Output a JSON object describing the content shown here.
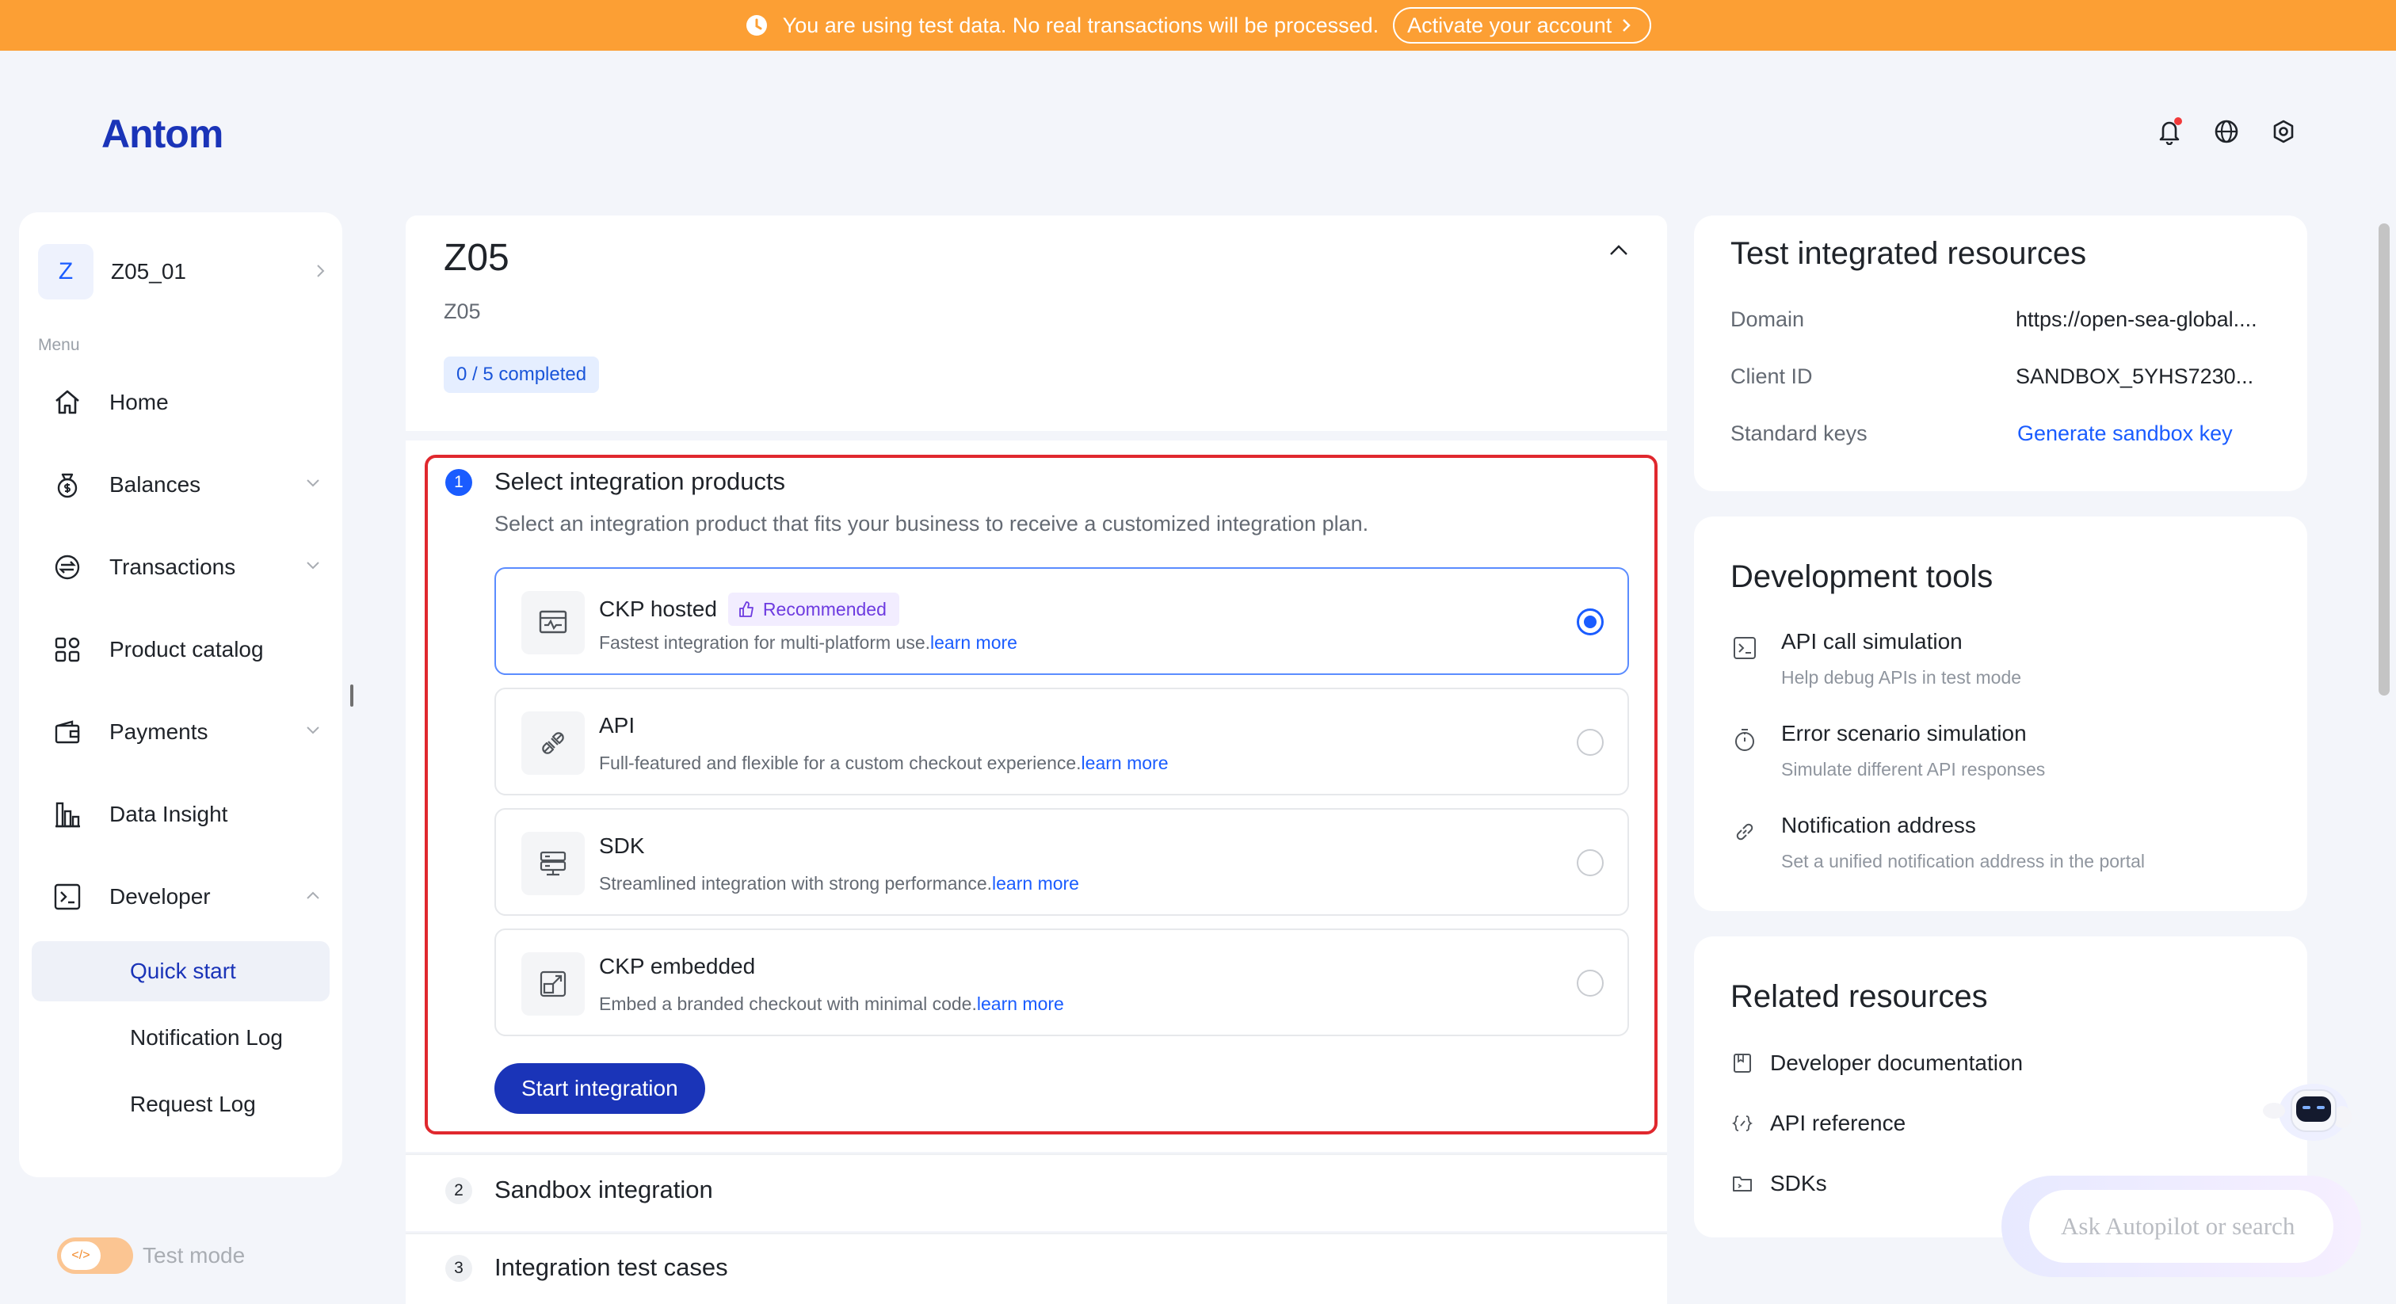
{
  "banner": {
    "message": "You are using test data. No real transactions will be processed.",
    "activate_label": "Activate your account"
  },
  "header": {
    "logo": "Antom"
  },
  "sidebar": {
    "account": {
      "initial": "Z",
      "name": "Z05_01"
    },
    "menu_label": "Menu",
    "items": [
      {
        "label": "Home"
      },
      {
        "label": "Balances"
      },
      {
        "label": "Transactions"
      },
      {
        "label": "Product catalog"
      },
      {
        "label": "Payments"
      },
      {
        "label": "Data Insight"
      },
      {
        "label": "Developer"
      }
    ],
    "developer_sub": [
      {
        "label": "Quick start",
        "active": true
      },
      {
        "label": "Notification Log"
      },
      {
        "label": "Request Log"
      }
    ],
    "test_mode_label": "Test mode"
  },
  "main": {
    "title": "Z05",
    "subtitle": "Z05",
    "progress": "0 / 5 completed",
    "steps": [
      {
        "number": "1",
        "title": "Select integration products",
        "description": "Select an integration product that fits your business to receive a customized integration plan.",
        "options": [
          {
            "title": "CKP hosted",
            "badge": "Recommended",
            "description": "Fastest integration for multi-platform use.",
            "link": "learn more",
            "selected": true
          },
          {
            "title": "API",
            "description": "Full-featured and flexible for a custom checkout experience.",
            "link": "learn more",
            "selected": false
          },
          {
            "title": "SDK",
            "description": "Streamlined integration with strong performance.",
            "link": "learn more",
            "selected": false
          },
          {
            "title": "CKP embedded",
            "description": "Embed a branded checkout with minimal code.",
            "link": "learn more",
            "selected": false
          }
        ],
        "cta": "Start integration"
      },
      {
        "number": "2",
        "title": "Sandbox integration"
      },
      {
        "number": "3",
        "title": "Integration test cases"
      }
    ]
  },
  "right": {
    "test_resources": {
      "title": "Test integrated resources",
      "rows": [
        {
          "key": "Domain",
          "value": "https://open-sea-global...."
        },
        {
          "key": "Client ID",
          "value": "SANDBOX_5YHS7230..."
        },
        {
          "key": "Standard keys",
          "link": "Generate sandbox key"
        }
      ]
    },
    "dev_tools": {
      "title": "Development tools",
      "items": [
        {
          "title": "API call simulation",
          "description": "Help debug APIs in test mode"
        },
        {
          "title": "Error scenario simulation",
          "description": "Simulate different API responses"
        },
        {
          "title": "Notification address",
          "description": "Set a unified notification address in the portal"
        }
      ]
    },
    "related": {
      "title": "Related resources",
      "items": [
        {
          "label": "Developer documentation"
        },
        {
          "label": "API reference"
        },
        {
          "label": "SDKs"
        }
      ]
    }
  },
  "autopilot": {
    "placeholder": "Ask Autopilot or search"
  },
  "colors": {
    "brand": "#1a34b8",
    "accent": "#1a5cff",
    "banner": "#fc9f34",
    "highlight_border": "#e0282e"
  }
}
